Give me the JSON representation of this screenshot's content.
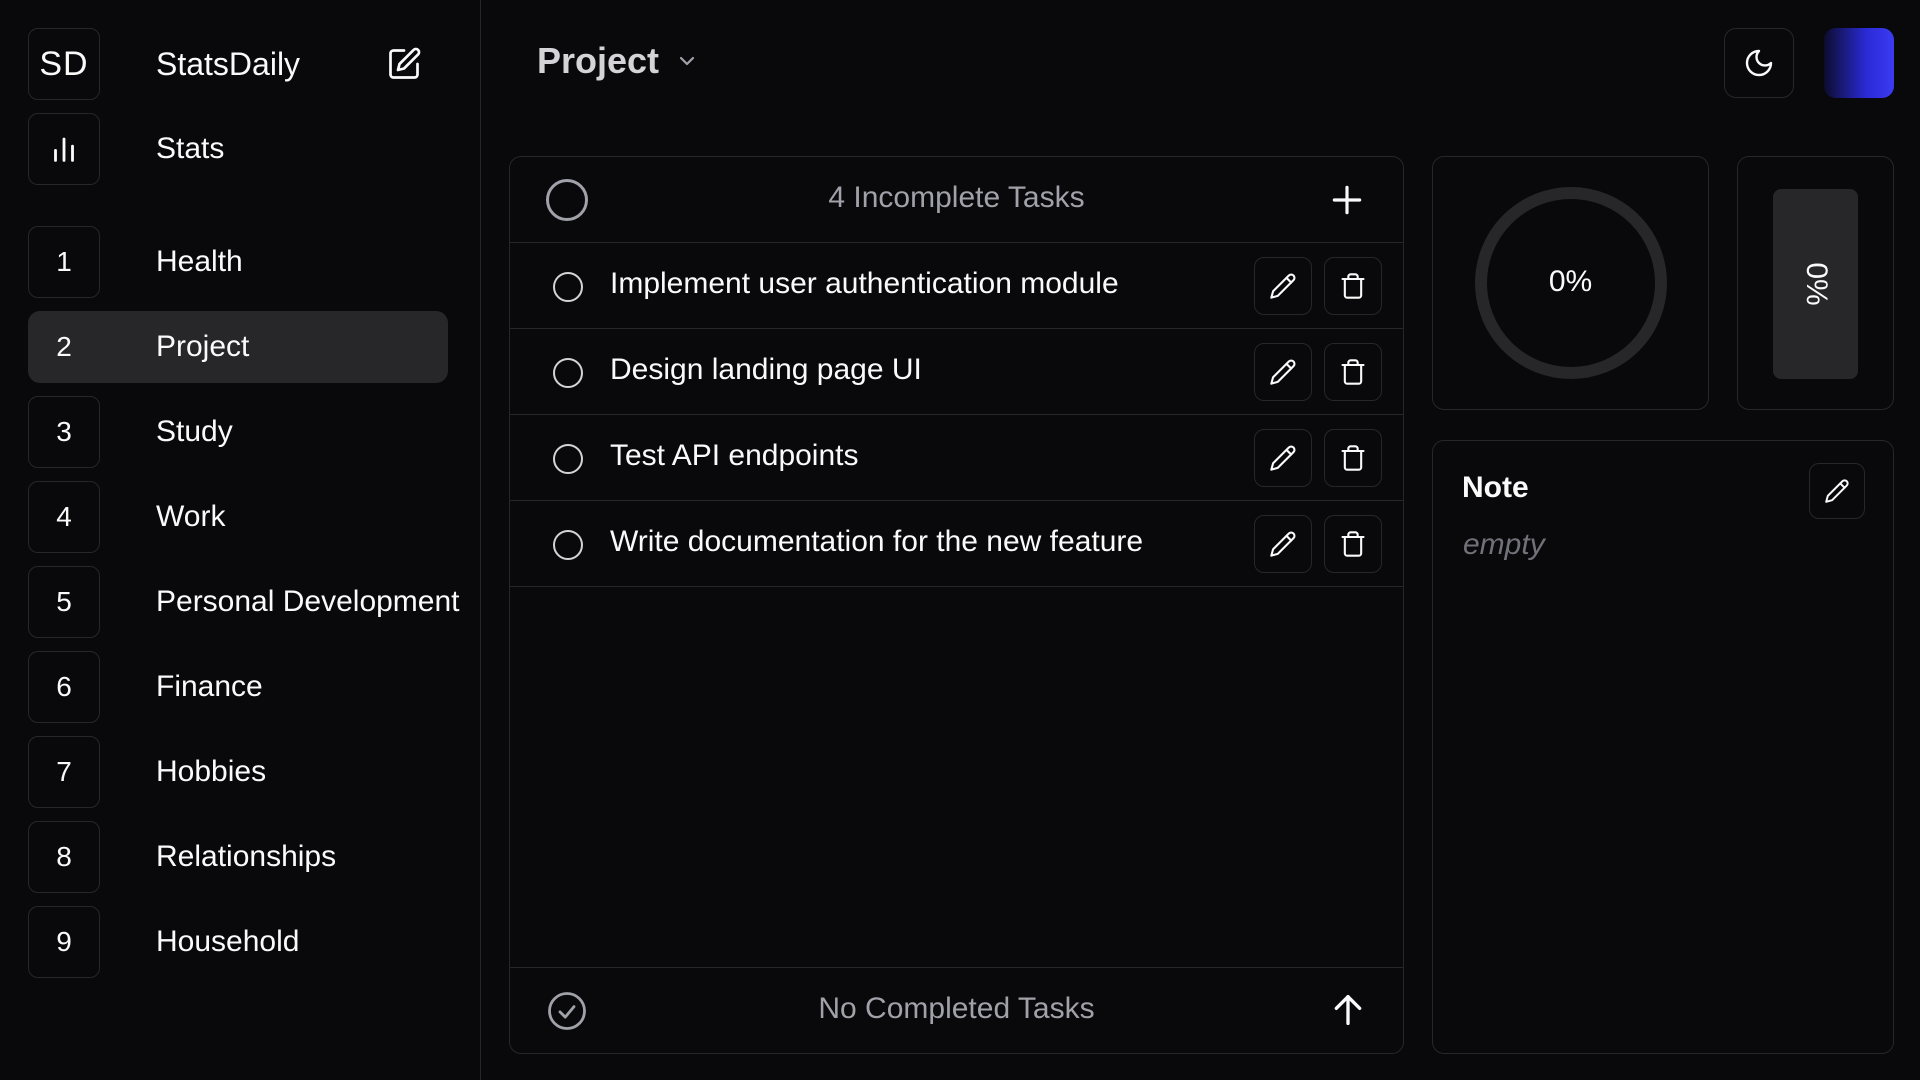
{
  "brand": {
    "initials": "SD",
    "name": "StatsDaily"
  },
  "sidebar": {
    "stats_label": "Stats",
    "items": [
      {
        "number": "1",
        "label": "Health"
      },
      {
        "number": "2",
        "label": "Project",
        "active": true
      },
      {
        "number": "3",
        "label": "Study"
      },
      {
        "number": "4",
        "label": "Work"
      },
      {
        "number": "5",
        "label": "Personal Development"
      },
      {
        "number": "6",
        "label": "Finance"
      },
      {
        "number": "7",
        "label": "Hobbies"
      },
      {
        "number": "8",
        "label": "Relationships"
      },
      {
        "number": "9",
        "label": "Household"
      }
    ]
  },
  "header": {
    "title": "Project",
    "dropdown_icon": "chevron-down-icon",
    "theme_icon": "moon-icon"
  },
  "tasks": {
    "incomplete_title": "4 Incomplete Tasks",
    "items": [
      {
        "text": "Implement user authentication module"
      },
      {
        "text": "Design landing page UI"
      },
      {
        "text": "Test API endpoints"
      },
      {
        "text": "Write documentation for the new feature"
      }
    ],
    "completed_title": "No Completed Tasks"
  },
  "stats": {
    "ring_value": 0,
    "ring_label": "0%",
    "bar_value": 0,
    "bar_label": "0%"
  },
  "note": {
    "title": "Note",
    "body": "empty"
  },
  "colors": {
    "background": "#09090b",
    "border": "#27272a",
    "active_row": "#27272a",
    "muted_text": "#a1a1aa",
    "avatar_gradient_end": "#3b3bf2"
  }
}
